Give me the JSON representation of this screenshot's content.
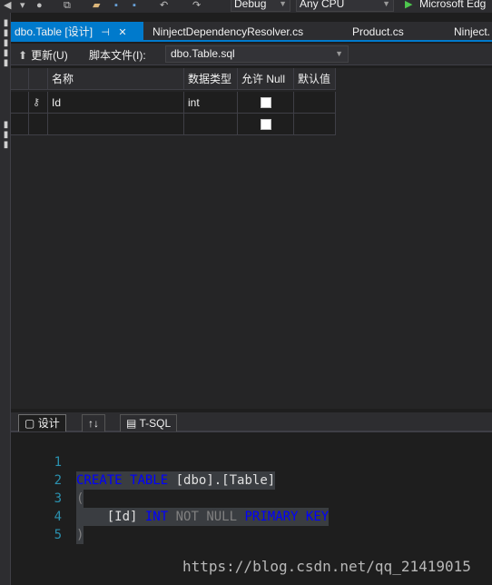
{
  "toolbar": {
    "config": "Debug",
    "platform": "Any CPU",
    "run_target": "Microsoft Edg"
  },
  "tabs": [
    {
      "label": "dbo.Table [设计]",
      "active": true
    },
    {
      "label": "NinjectDependencyResolver.cs",
      "active": false
    },
    {
      "label": "Product.cs",
      "active": false
    },
    {
      "label": "Ninject.",
      "active": false
    }
  ],
  "designer": {
    "update_label": "更新(U)",
    "script_label": "脚本文件(I):",
    "script_value": "dbo.Table.sql"
  },
  "grid": {
    "columns": [
      "名称",
      "数据类型",
      "允许 Null",
      "默认值"
    ],
    "rows": [
      {
        "name": "Id",
        "type": "int",
        "allow_null": false,
        "default": "",
        "key": true
      },
      {
        "name": "",
        "type": "",
        "allow_null": false,
        "default": "",
        "key": false
      }
    ]
  },
  "pane_tabs": {
    "design": "设计",
    "swap": "↑↓",
    "tsql": "T-SQL"
  },
  "editor": {
    "line_numbers": [
      "1",
      "2",
      "3",
      "4",
      "5"
    ],
    "l1_kw1": "CREATE",
    "l1_kw2": "TABLE",
    "l1_ident": "[dbo].[Table]",
    "l2": "(",
    "l3_ident": "[Id]",
    "l3_type": "INT",
    "l3_notnull": "NOT NULL",
    "l3_pk": "PRIMARY KEY",
    "l4": ")"
  },
  "watermark": "https://blog.csdn.net/qq_21419015",
  "colors": {
    "accent": "#007acc",
    "background": "#1e1e1e",
    "keyword": "#0000ff",
    "line_number": "#2b91af"
  }
}
